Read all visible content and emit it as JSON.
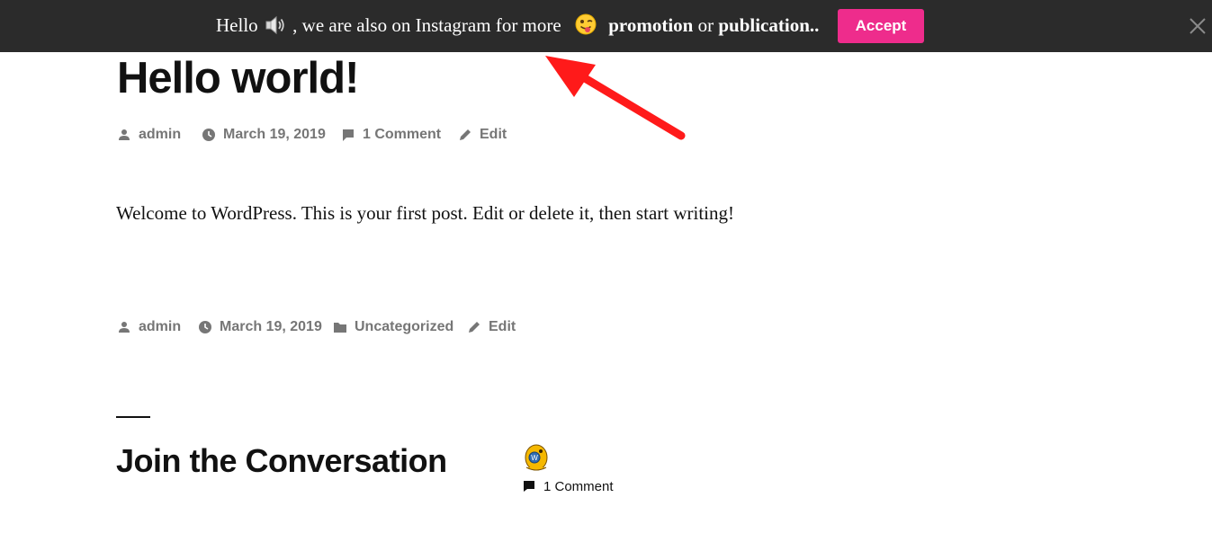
{
  "notice": {
    "text_hello": "Hello",
    "text_middle": ", we are also on Instagram for more",
    "text_bold1": "promotion",
    "text_or": "or",
    "text_bold2": "publication..",
    "accept_label": "Accept",
    "accent_color": "#ee2c8c",
    "background": "#2b2b2b",
    "speaker_icon": "speaker-icon",
    "emoji_icon": "winking-tongue-emoji-icon",
    "close_icon": "close-icon"
  },
  "post": {
    "title": "Hello world!",
    "meta_top": {
      "author": "admin",
      "date": "March 19, 2019",
      "comments": "1 Comment",
      "edit": "Edit"
    },
    "content": "Welcome to WordPress. This is your first post. Edit or delete it, then start writing!",
    "meta_bottom": {
      "author": "admin",
      "date": "March 19, 2019",
      "category": "Uncategorized",
      "edit": "Edit"
    }
  },
  "conversation": {
    "title": "Join the Conversation",
    "comment_count": "1 Comment",
    "avatar_icon": "wapuu-avatar-icon"
  },
  "annotation": {
    "arrow_color": "#ff1a1a"
  }
}
